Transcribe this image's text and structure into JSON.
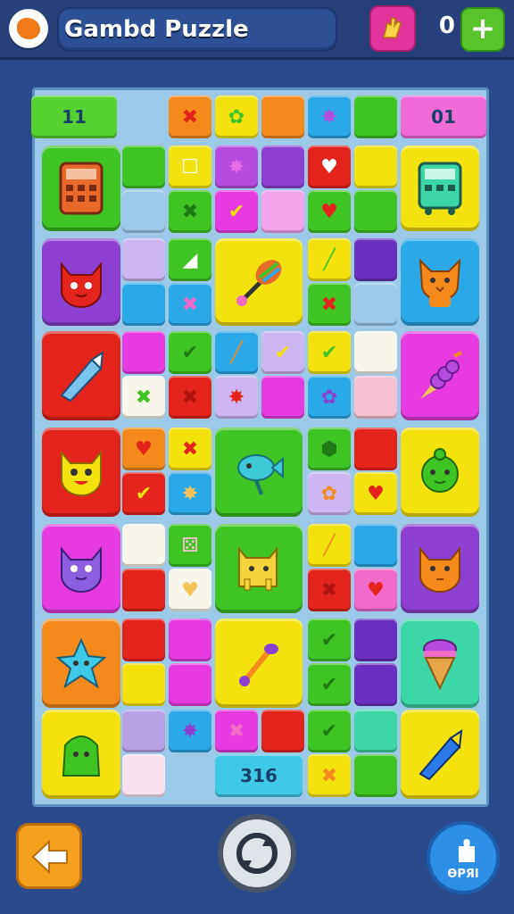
{
  "header": {
    "title": "Gambd Puzzle",
    "score": "0",
    "plus_label": "+"
  },
  "board": {
    "level_label": "11",
    "moves_label": "01",
    "bottom_tile_label": "316",
    "colors": {
      "green": "#3ec524",
      "yellow": "#f4e20f",
      "orange": "#f58a1c",
      "blue": "#2aa8e8",
      "purple": "#8c3fd0",
      "magenta": "#e53be0",
      "red": "#e4231a",
      "pink": "#f06ac8",
      "lilac": "#cdb5ef",
      "white": "#f8f6ea",
      "teal": "#3dd6a6",
      "blush": "#f6c1d0"
    }
  },
  "footer": {
    "hint_label": "ƟPЯI"
  }
}
